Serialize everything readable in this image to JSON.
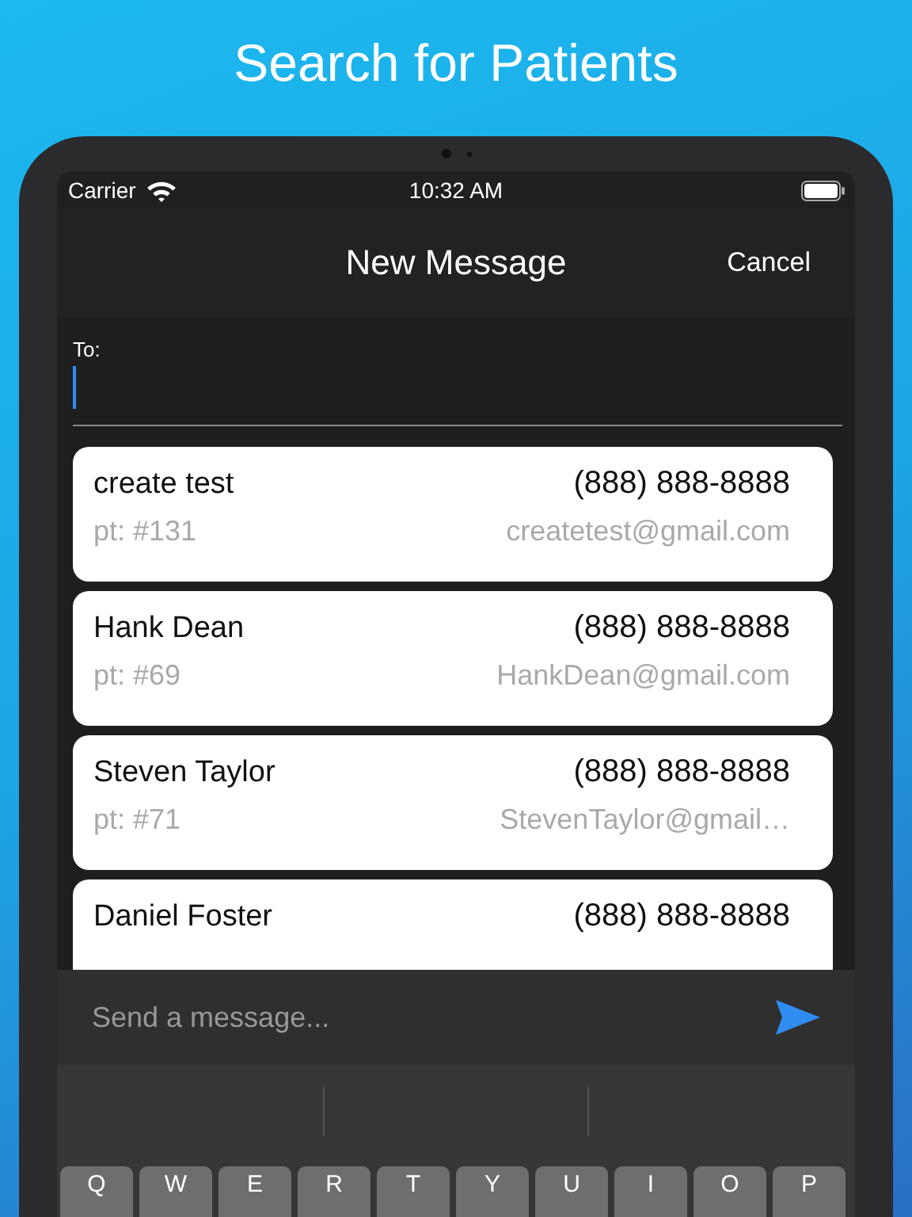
{
  "headline": "Search for Patients",
  "status_bar": {
    "carrier": "Carrier",
    "time": "10:32 AM"
  },
  "nav": {
    "title": "New Message",
    "action": "Cancel"
  },
  "to_field": {
    "label": "To:",
    "focused": true
  },
  "patients": [
    {
      "name": "create test",
      "phone": "(888) 888-8888",
      "patient_id": "pt: #131",
      "email": "createtest@gmail.com"
    },
    {
      "name": "Hank Dean",
      "phone": "(888) 888-8888",
      "patient_id": "pt: #69",
      "email": "HankDean@gmail.com"
    },
    {
      "name": "Steven Taylor",
      "phone": "(888) 888-8888",
      "patient_id": "pt: #71",
      "email": "StevenTaylor@gmail…"
    },
    {
      "name": "Daniel Foster",
      "phone": "(888) 888-8888"
    }
  ],
  "composer": {
    "placeholder": "Send a message..."
  },
  "keyboard": {
    "keys": [
      "Q",
      "W",
      "E",
      "R",
      "T",
      "Y",
      "U",
      "I",
      "O",
      "P"
    ]
  }
}
